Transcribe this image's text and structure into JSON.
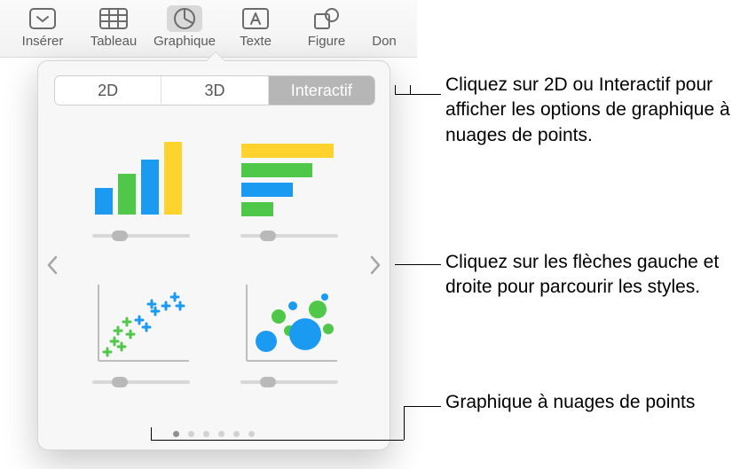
{
  "toolbar": {
    "items": [
      {
        "label": "Insérer",
        "icon": "square-caret-down-icon"
      },
      {
        "label": "Tableau",
        "icon": "table-icon"
      },
      {
        "label": "Graphique",
        "icon": "pie-chart-icon",
        "active": true
      },
      {
        "label": "Texte",
        "icon": "textbox-icon"
      },
      {
        "label": "Figure",
        "icon": "shapes-icon"
      },
      {
        "label": "Don",
        "icon": "unknown-icon"
      }
    ]
  },
  "popover": {
    "tabs": [
      {
        "label": "2D",
        "active": false
      },
      {
        "label": "3D",
        "active": false
      },
      {
        "label": "Interactif",
        "active": true
      }
    ],
    "options": [
      {
        "name": "interactive-column-chart"
      },
      {
        "name": "interactive-bar-chart"
      },
      {
        "name": "interactive-scatter-chart"
      },
      {
        "name": "interactive-bubble-chart"
      }
    ],
    "page_count": 6,
    "current_page": 1
  },
  "callouts": {
    "tabs": "Cliquez sur 2D ou Interactif pour afficher les options de graphique à nuages de points.",
    "arrows": "Cliquez sur les flèches gauche et droite pour parcourir les styles.",
    "scatter": "Graphique à nuages de points"
  },
  "colors": {
    "blue": "#1A9AF0",
    "green": "#4FC749",
    "yellow": "#FFD22E",
    "slider_track": "#d8d8d8",
    "slider_thumb": "#b9b9b9"
  }
}
